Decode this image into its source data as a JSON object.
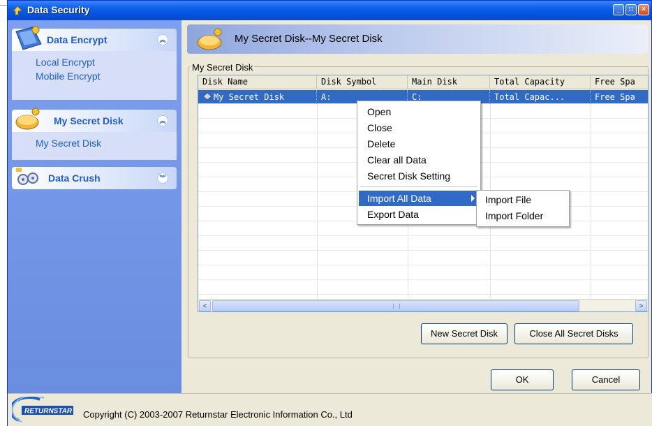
{
  "window": {
    "title": "Data Security"
  },
  "sidebar": {
    "groups": [
      {
        "label": "Data Encrypt",
        "items": [
          "Local Encrypt",
          "Mobile Encrypt"
        ]
      },
      {
        "label": "My Secret Disk",
        "items": [
          "My Secret Disk"
        ]
      },
      {
        "label": "Data Crush",
        "items": []
      }
    ]
  },
  "header": {
    "title": "My Secret Disk--My Secret Disk"
  },
  "panel": {
    "legend": "My Secret Disk"
  },
  "table": {
    "columns": [
      "Disk Name",
      "Disk Symbol",
      "Main Disk",
      "Total Capacity",
      "Free Spa"
    ],
    "rows": [
      {
        "name": "My Secret Disk",
        "symbol": "A:",
        "main": "C:",
        "total": "Total Capac...",
        "free": "Free Spa"
      }
    ]
  },
  "context_menu": {
    "items": [
      "Open",
      "Close",
      "Delete",
      "Clear all Data",
      "Secret Disk Setting",
      "Import All Data",
      "Export Data"
    ],
    "submenu": [
      "Import File",
      "Import Folder"
    ]
  },
  "buttons": {
    "new_disk": "New Secret Disk",
    "close_all": "Close All Secret Disks",
    "ok": "OK",
    "cancel": "Cancel"
  },
  "footer": {
    "copyright": "Copyright (C) 2003-2007 Returnstar Electronic Information Co., Ltd",
    "logo_text": "RETURNSTAR"
  }
}
